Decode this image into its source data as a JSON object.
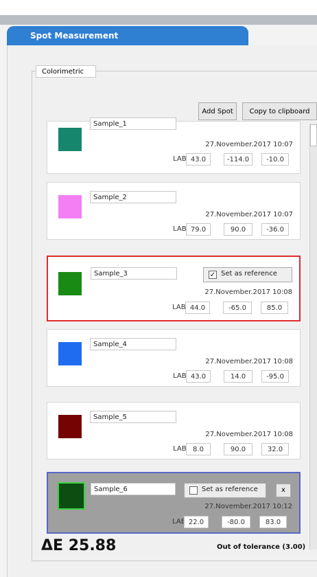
{
  "header": {
    "tab_title": "Spot Measurement"
  },
  "group": {
    "label": "Colorimetric"
  },
  "toolbar": {
    "add_spot": "Add Spot",
    "copy": "Copy to clipboard"
  },
  "lab_label": "LAB:",
  "reference_label": "Set as reference",
  "close_label": "x",
  "checkmark": "✓",
  "samples": [
    {
      "name": "Sample_1",
      "time": "27.November.2017 10:07",
      "lab": [
        "43.0",
        "-114.0",
        "-10.0"
      ],
      "color": "#16866d"
    },
    {
      "name": "Sample_2",
      "time": "27.November.2017 10:07",
      "lab": [
        "79.0",
        "90.0",
        "-36.0"
      ],
      "color": "#f47ef4"
    },
    {
      "name": "Sample_3",
      "time": "27.November.2017 10:08",
      "lab": [
        "44.0",
        "-65.0",
        "85.0"
      ],
      "color": "#198a14"
    },
    {
      "name": "Sample_4",
      "time": "27.November.2017 10:08",
      "lab": [
        "43.0",
        "14.0",
        "-95.0"
      ],
      "color": "#1f6cf0"
    },
    {
      "name": "Sample_5",
      "time": "27.November.2017 10:08",
      "lab": [
        "8.0",
        "90.0",
        "32.0"
      ],
      "color": "#750304"
    },
    {
      "name": "Sample_6",
      "time": "27.November.2017 10:12",
      "lab": [
        "22.0",
        "-80.0",
        "83.0"
      ],
      "color": "#0d4d12"
    }
  ],
  "result": {
    "delta_e": "ΔE 25.88",
    "tolerance": "Out of tolerance (3.00)"
  }
}
